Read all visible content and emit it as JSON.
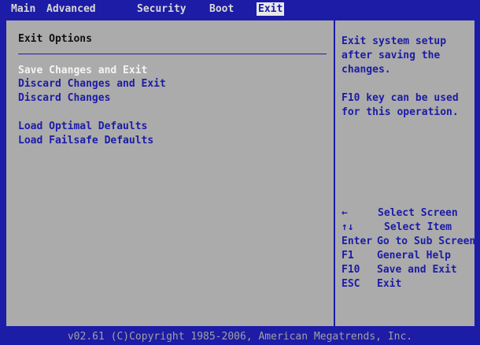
{
  "tabs": [
    {
      "label": "Main"
    },
    {
      "label": "Advanced"
    },
    {
      "label": "Security"
    },
    {
      "label": "Boot"
    },
    {
      "label": "Exit"
    }
  ],
  "active_tab": "Exit",
  "panel": {
    "title": "Exit Options",
    "options": [
      {
        "label": "Save Changes and Exit"
      },
      {
        "label": "Discard Changes and Exit"
      },
      {
        "label": "Discard Changes"
      },
      {
        "label": "Load Optimal Defaults"
      },
      {
        "label": "Load Failsafe Defaults"
      }
    ]
  },
  "help": {
    "text": "Exit system setup\nafter saving the\nchanges.\n\nF10 key can be used\nfor this operation."
  },
  "keys": [
    {
      "key": "←",
      "desc": "Select Screen"
    },
    {
      "key": "↑↓",
      "desc": "Select Item"
    },
    {
      "key": "Enter",
      "desc": "Go to Sub Screen"
    },
    {
      "key": "F1",
      "desc": "General Help"
    },
    {
      "key": "F10",
      "desc": "Save and Exit"
    },
    {
      "key": "ESC",
      "desc": "Exit"
    }
  ],
  "footer": "v02.61 (C)Copyright 1985-2006, American Megatrends, Inc.",
  "colors": {
    "background": "#1c1ca6",
    "panel": "#ababab",
    "selected_text": "#f4f4f4",
    "menu_text": "#d8d8d8"
  }
}
